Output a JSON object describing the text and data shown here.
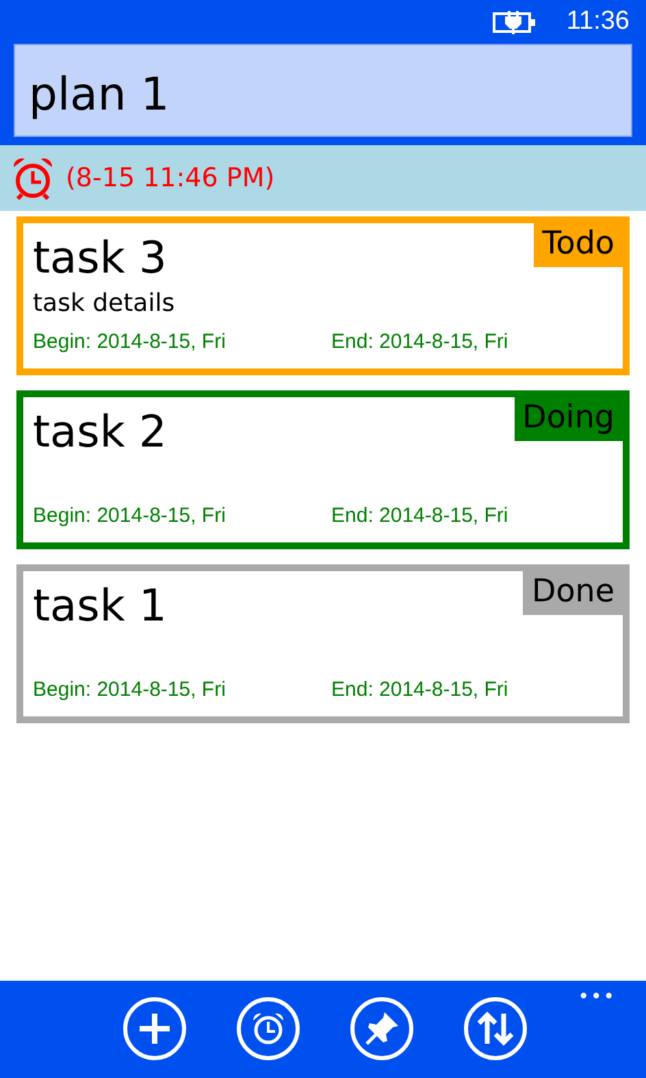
{
  "status_bar": {
    "time": "11:36"
  },
  "title_field": {
    "value": "plan 1"
  },
  "alarm": {
    "text": "(8-15 11:46 PM)"
  },
  "tasks": [
    {
      "title": "task 3",
      "details": "task details",
      "status": "Todo",
      "color": "#ffa500",
      "begin": "Begin: 2014-8-15, Fri",
      "end": "End: 2014-8-15, Fri"
    },
    {
      "title": "task 2",
      "status": "Doing",
      "color": "#008000",
      "begin": "Begin: 2014-8-15, Fri",
      "end": "End: 2014-8-15, Fri"
    },
    {
      "title": "task 1",
      "status": "Done",
      "color": "#a9a9a9",
      "begin": "Begin: 2014-8-15, Fri",
      "end": "End: 2014-8-15, Fri"
    }
  ],
  "app_bar": {
    "buttons": [
      {
        "kind": "add"
      },
      {
        "kind": "alarm"
      },
      {
        "kind": "pin"
      },
      {
        "kind": "sort"
      }
    ],
    "more": "•••"
  }
}
